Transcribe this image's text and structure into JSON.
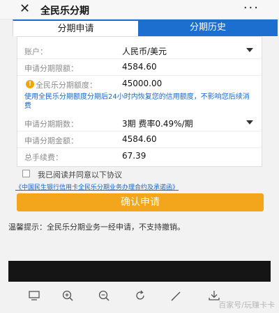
{
  "header": {
    "close_icon": "close-icon",
    "title": "全民乐分期",
    "more_icon": "more-icon"
  },
  "tabs": [
    {
      "label": "分期申请",
      "active": true
    },
    {
      "label": "分期历史",
      "active": false
    }
  ],
  "form": {
    "account": {
      "label": "账户：",
      "value": "人民币/美元"
    },
    "limit": {
      "label": "申请分期限额：",
      "value": "4584.60"
    },
    "quota": {
      "label": "全民乐分期额度：",
      "value": "45000.00"
    },
    "note": "使用全民乐分期额度分期后24小时内恢复您的信用额度，不影响您后续消费",
    "periods": {
      "label": "申请分期期数：",
      "value": "3期 费率0.49%/期"
    },
    "amount": {
      "label": "申请分期金额：",
      "value": "4584.60"
    },
    "fee": {
      "label": "总手续费：",
      "value": "67.39"
    }
  },
  "agreement": {
    "checkbox_label": "我已阅读并同意以下协议",
    "link": "《中国民生银行信用卡全民乐分期业务办理合约及承诺函》"
  },
  "confirm_button": "确认申请",
  "tip": "温馨提示：全民乐分期业务一经申请，不支持撤销。",
  "watermark": "百家号/玩赚卡卡",
  "colors": {
    "accent_blue": "#1d6fcf",
    "button_orange": "#f3a51c",
    "note_blue": "#1a66c8"
  }
}
